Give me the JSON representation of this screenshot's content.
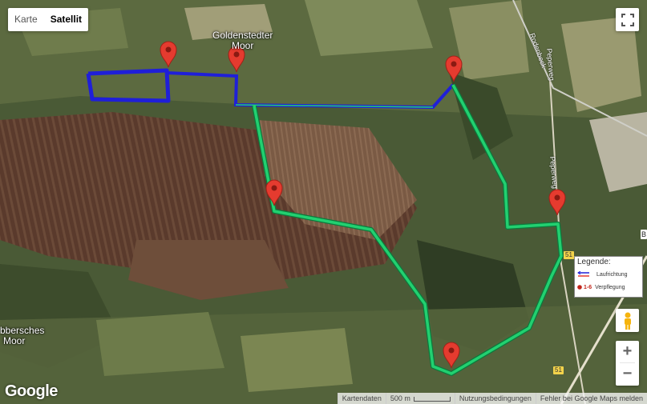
{
  "map_type_control": {
    "options": [
      "Karte",
      "Satellit"
    ],
    "selected": "Satellit"
  },
  "place_labels": {
    "goldenstedter_moor": [
      "Goldenstedter",
      "Moor"
    ],
    "bbersches_moor": [
      "bbersches",
      "Moor"
    ]
  },
  "road_labels": {
    "rodenbeck": "Rodenbeck",
    "peperweg_north": "Peperweg",
    "peperweg_south": "Peperweg"
  },
  "road_shields": {
    "shield_east": "51",
    "shield_south": "51",
    "shield_edge": "B"
  },
  "legend": {
    "title": "Legende:",
    "items": [
      {
        "icon": "arrow-icon",
        "label": "Laufrichtung"
      },
      {
        "icon": "marker-icon",
        "range": "1-6",
        "label": "Verpflegung"
      }
    ]
  },
  "footer": {
    "map_data": "Kartendaten",
    "scale": "500 m",
    "terms": "Nutzungsbedingungen",
    "report": "Fehler bei Google Maps melden"
  },
  "logo": "Google",
  "controls": {
    "zoom_in": "+",
    "zoom_out": "−"
  },
  "route": {
    "colors": {
      "blue": "#1f1fd8",
      "green": "#1fc46a",
      "marker": "#e53b2f"
    },
    "marker_count": 6
  }
}
